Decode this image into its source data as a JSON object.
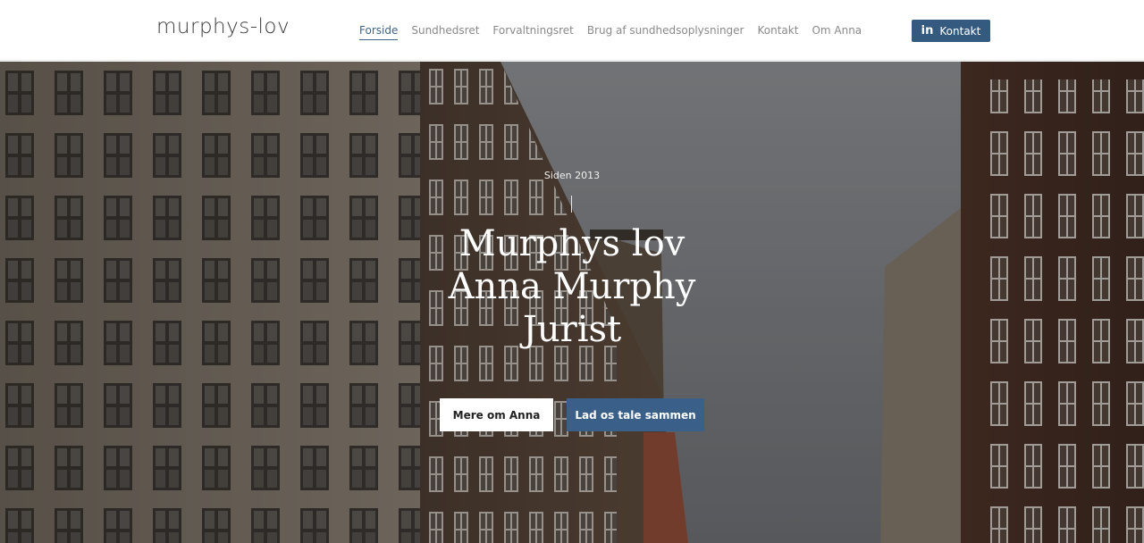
{
  "header": {
    "logo": "murphys-lov",
    "nav": [
      {
        "label": "Forside"
      },
      {
        "label": "Sundhedsret"
      },
      {
        "label": "Forvaltningsret"
      },
      {
        "label": "Brug af sundhedsoplysninger"
      },
      {
        "label": "Kontakt"
      },
      {
        "label": "Om Anna"
      }
    ],
    "linkedin_button": {
      "icon": "linkedin-icon",
      "icon_glyph": "in",
      "label": "Kontakt"
    }
  },
  "hero": {
    "since": "Siden 2013",
    "title_lines": [
      "Murphys lov",
      "Anna Murphy",
      "Jurist"
    ],
    "buttons": {
      "primary": "Mere om Anna",
      "secondary": "Lad os tale sammen"
    }
  },
  "colors": {
    "accent": "#3a5f88",
    "nav_text": "#8a8a8a"
  }
}
